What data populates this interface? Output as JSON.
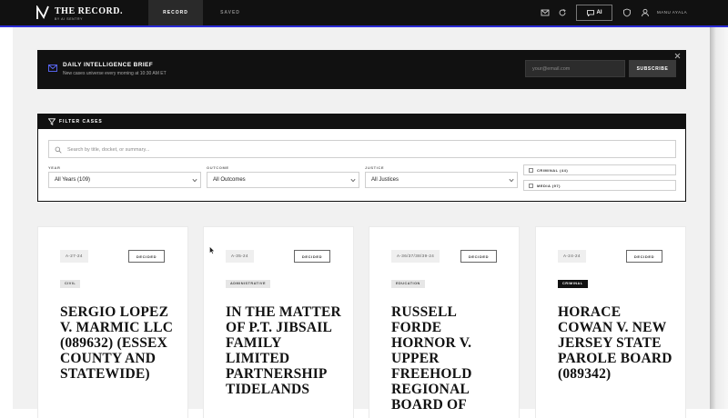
{
  "app": {
    "title": "THE RECORD.",
    "subtitle": "BY AI SENTRY"
  },
  "nav": {
    "tabs": [
      {
        "label": "RECORD",
        "active": true
      },
      {
        "label": "SAVED",
        "active": false
      }
    ],
    "ai_label": "AI",
    "user_name": "MANU AYALA"
  },
  "brief": {
    "title": "DAILY INTELLIGENCE BRIEF",
    "subtitle": "New cases universe every morning at 10:30 AM ET",
    "email_placeholder": "your@email.com",
    "subscribe_label": "SUBSCRIBE"
  },
  "filter": {
    "title": "FILTER CASES",
    "search_placeholder": "Search by title, docket, or summary...",
    "year_label": "YEAR",
    "year_value": "All Years (109)",
    "outcome_label": "OUTCOME",
    "outcome_value": "All Outcomes",
    "justice_label": "JUSTICE",
    "justice_value": "All Justices",
    "checkboxes": [
      {
        "label": "CRIMINAL (44)",
        "checked": false
      },
      {
        "label": "MEDIA (97)",
        "checked": false
      }
    ]
  },
  "cards": [
    {
      "docket": "A-27-24",
      "status": "DECIDED",
      "category": "CIVIL",
      "title": "SERGIO LOPEZ V. MARMIC LLC (089632) (ESSEX COUNTY AND STATEWIDE)"
    },
    {
      "docket": "A-35-24",
      "status": "DECIDED",
      "category": "ADMINISTRATIVE",
      "title": "IN THE MATTER OF P.T. JIBSAIL FAMILY LIMITED PARTNERSHIP TIDELANDS"
    },
    {
      "docket": "A-36/37/38/39-24",
      "status": "DECIDED",
      "category": "EDUCATION",
      "title": "RUSSELL FORDE HORNOR V. UPPER FREEHOLD REGIONAL BOARD OF"
    },
    {
      "docket": "A-24-24",
      "status": "DECIDED",
      "category": "CRIMINAL",
      "title": "HORACE COWAN V. NEW JERSEY STATE PAROLE BOARD (089342)"
    }
  ],
  "colors": {
    "topbar": "#111111",
    "accent_line": "#2b2bd6",
    "background": "#f1f1f1",
    "card": "#ffffff"
  }
}
